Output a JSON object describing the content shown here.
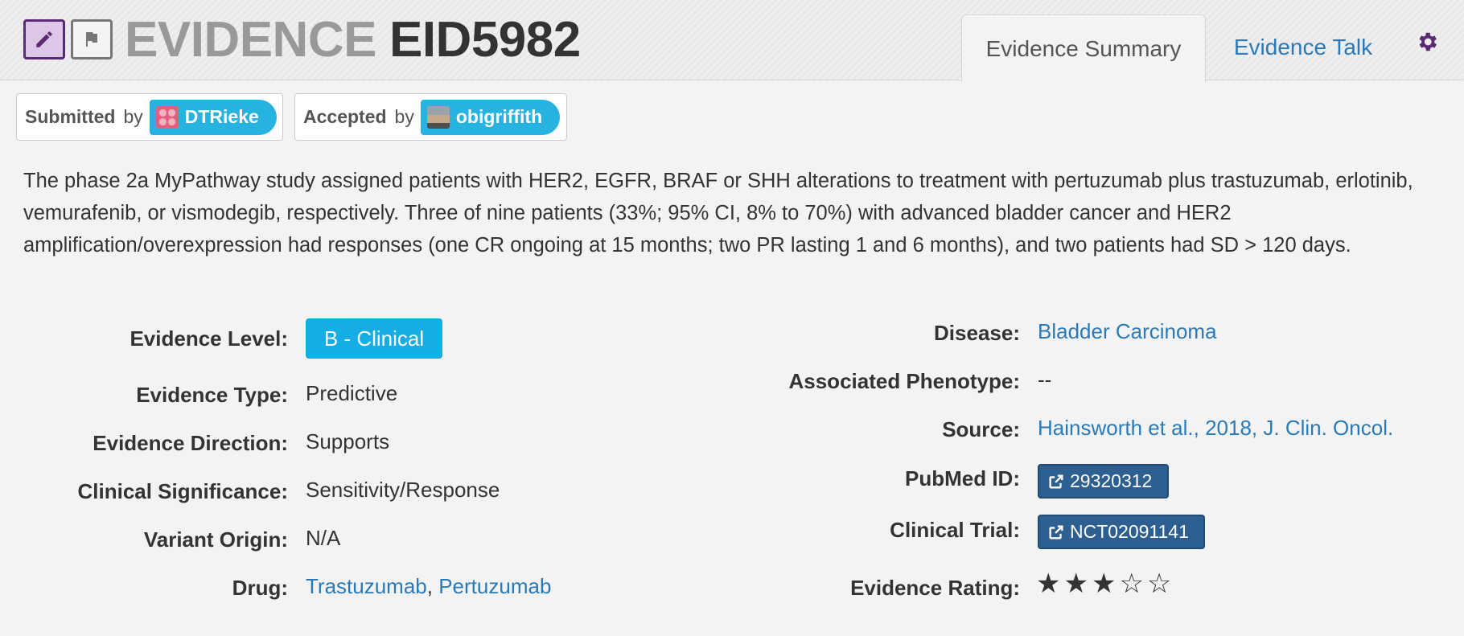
{
  "header": {
    "title_prefix": "EVIDENCE",
    "title_id": "EID5982",
    "tabs": [
      {
        "label": "Evidence Summary",
        "active": true
      },
      {
        "label": "Evidence Talk",
        "active": false
      }
    ],
    "icons": {
      "edit": "pencil-icon",
      "flag": "flag-icon",
      "settings": "gear-icon"
    },
    "accent_color": "#5b2a74"
  },
  "submitted": {
    "label": "Submitted",
    "by": "by",
    "user": "DTRieke"
  },
  "accepted": {
    "label": "Accepted",
    "by": "by",
    "user": "obigriffith"
  },
  "description": "The phase 2a MyPathway study assigned patients with HER2, EGFR, BRAF or SHH alterations to treatment with pertuzumab plus trastuzumab, erlotinib, vemurafenib, or vismodegib, respectively. Three of nine patients (33%; 95% CI, 8% to 70%) with advanced bladder cancer and HER2 amplification/overexpression had responses (one CR ongoing at 15 months; two PR lasting 1 and 6 months), and two patients had SD > 120 days.",
  "fields_left": {
    "evidence_level": {
      "label": "Evidence Level:",
      "value": "B - Clinical"
    },
    "evidence_type": {
      "label": "Evidence Type:",
      "value": "Predictive"
    },
    "evidence_direction": {
      "label": "Evidence Direction:",
      "value": "Supports"
    },
    "clinical_significance": {
      "label": "Clinical Significance:",
      "value": "Sensitivity/Response"
    },
    "variant_origin": {
      "label": "Variant Origin:",
      "value": "N/A"
    },
    "drug": {
      "label": "Drug:",
      "values": [
        "Trastuzumab",
        "Pertuzumab"
      ],
      "separator": ", "
    }
  },
  "fields_right": {
    "disease": {
      "label": "Disease:",
      "value": "Bladder Carcinoma"
    },
    "associated_phenotype": {
      "label": "Associated Phenotype:",
      "value": "--"
    },
    "source": {
      "label": "Source:",
      "value": "Hainsworth et al., 2018, J. Clin. Oncol."
    },
    "pubmed_id": {
      "label": "PubMed ID:",
      "value": "29320312"
    },
    "clinical_trial": {
      "label": "Clinical Trial:",
      "value": "NCT02091141"
    },
    "evidence_rating": {
      "label": "Evidence Rating:",
      "rating": 3,
      "max": 5,
      "stars_text": "★★★☆☆"
    }
  },
  "colors": {
    "link": "#2a7ab8",
    "level_badge": "#14aee5",
    "user_pill": "#27b3e0",
    "ext_button": "#2d5f91"
  }
}
